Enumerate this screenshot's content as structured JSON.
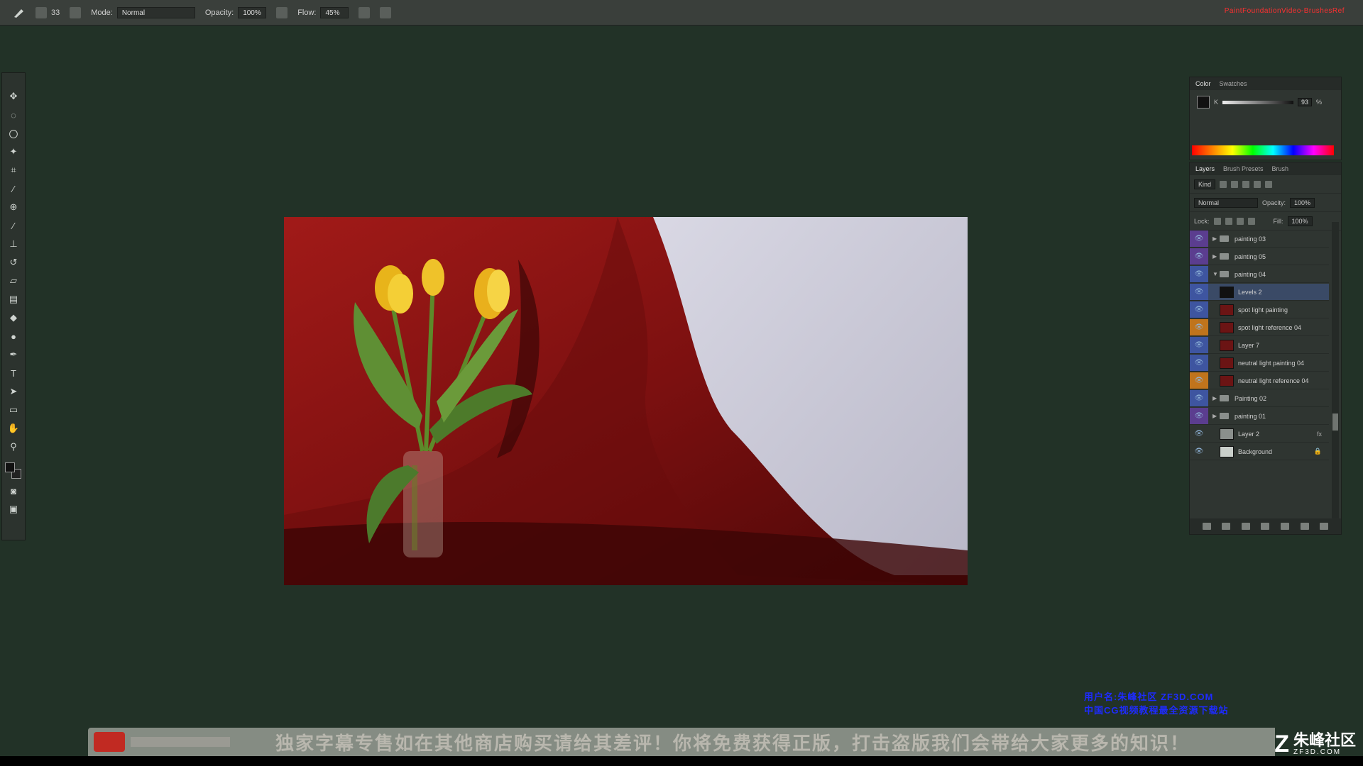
{
  "options_bar": {
    "mode_label": "Mode:",
    "mode_value": "Normal",
    "opacity_label": "Opacity:",
    "opacity_value": "100%",
    "flow_label": "Flow:",
    "flow_value": "45%",
    "brush_size": "33"
  },
  "window_title": "PaintFoundationVideo-BrushesRef",
  "color_panel": {
    "tabs": [
      "Color",
      "Swatches"
    ],
    "channel": "K",
    "value": "93",
    "unit": "%"
  },
  "layers_panel": {
    "tabs": [
      "Layers",
      "Brush Presets",
      "Brush"
    ],
    "kind_label": "Kind",
    "blend_mode": "Normal",
    "opacity_label": "Opacity:",
    "opacity_value": "100%",
    "lock_label": "Lock:",
    "fill_label": "Fill:",
    "fill_value": "100%",
    "layers": [
      {
        "name": "painting 03",
        "type": "group",
        "expanded": false,
        "color": "#5b3d8f"
      },
      {
        "name": "painting 05",
        "type": "group",
        "expanded": false,
        "color": "#5b3d8f"
      },
      {
        "name": "painting 04",
        "type": "group",
        "expanded": true,
        "color": "#3e55a0"
      },
      {
        "name": "Levels 2",
        "type": "adjustment",
        "color": "#3e55a0",
        "selected": true
      },
      {
        "name": "spot light painting",
        "type": "layer",
        "color": "#3e55a0"
      },
      {
        "name": "spot light reference 04",
        "type": "layer",
        "color": "#c0741c"
      },
      {
        "name": "Layer 7",
        "type": "layer",
        "color": "#3e55a0"
      },
      {
        "name": "neutral light painting 04",
        "type": "layer",
        "color": "#3e55a0"
      },
      {
        "name": "neutral light reference 04",
        "type": "layer",
        "color": "#c0741c"
      },
      {
        "name": "Painting 02",
        "type": "group",
        "expanded": false,
        "color": "#3e55a0"
      },
      {
        "name": "painting 01",
        "type": "group",
        "expanded": false,
        "color": "#5b3d8f"
      },
      {
        "name": "Layer 2",
        "type": "layer",
        "color": "none",
        "fx": "fx"
      },
      {
        "name": "Background",
        "type": "layer",
        "color": "none",
        "locked": true
      }
    ]
  },
  "watermark": {
    "line1": "用户名:朱峰社区 ZF3D.COM",
    "line2": "中国CG视频教程最全资源下载站"
  },
  "subtitle": {
    "text": "独家字幕专售如在其他商店购买请给其差评！你将免费获得正版，打击盗版我们会带给大家更多的知识！"
  },
  "site_mark": {
    "cn": "朱峰社区",
    "en": "ZF3D.COM"
  }
}
